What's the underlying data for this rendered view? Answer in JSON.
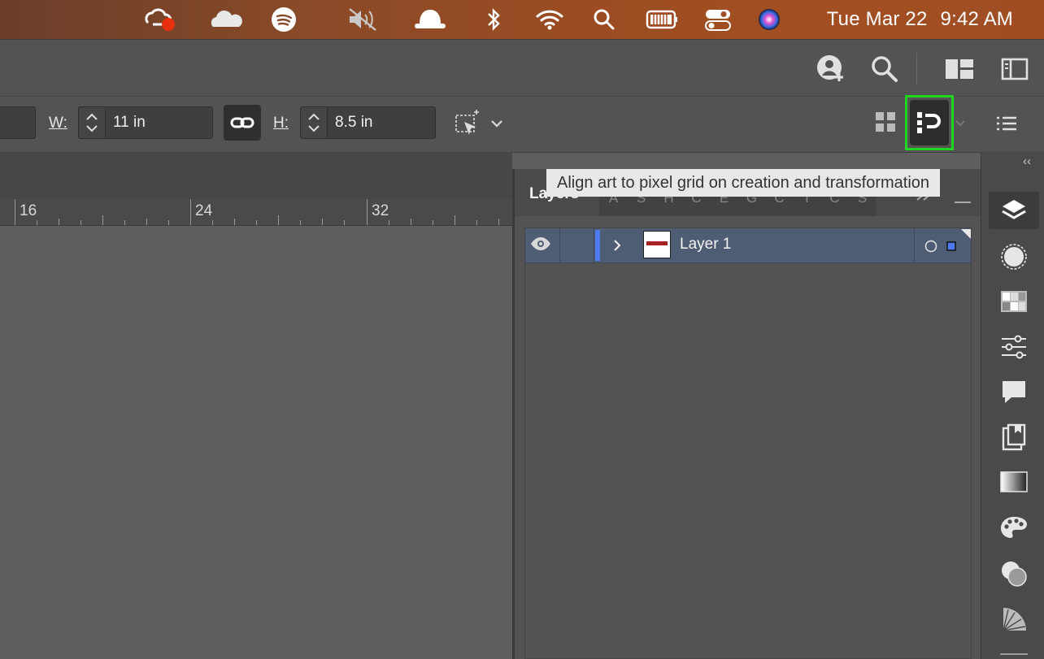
{
  "menubar": {
    "icons": [
      "creative-cloud-icon",
      "onedrive-icon",
      "spotify-icon",
      "muted-speaker-icon",
      "mask-icon",
      "bluetooth-icon",
      "wifi-icon",
      "spotlight-icon",
      "battery-icon",
      "control-center-icon",
      "siri-icon"
    ],
    "day_date": "Tue Mar 22",
    "time": "9:42 AM"
  },
  "appbar": {
    "icons": [
      "add-user-icon",
      "search-icon",
      "workspace-layout-icon",
      "panel-toggle-icon"
    ]
  },
  "controlbar": {
    "width_label": "W:",
    "width_value": "11 in",
    "height_label": "H:",
    "height_value": "8.5 in"
  },
  "tooltip": {
    "text": "Align art to pixel grid on creation and transformation"
  },
  "ruler": {
    "labels": [
      "16",
      "24",
      "32"
    ]
  },
  "layers_panel": {
    "title": "Layers",
    "tabs": [
      "A",
      "S",
      "H",
      "C",
      "E",
      "G",
      "C",
      "T",
      "C",
      "S"
    ],
    "layers": [
      {
        "name": "Layer 1",
        "visible": true,
        "color": "#4d7bef"
      }
    ]
  },
  "dock": {
    "collapse_label": "‹‹",
    "icons": [
      "layers-icon",
      "appearance-icon",
      "swatches-icon",
      "properties-icon",
      "comments-icon",
      "libraries-icon",
      "gradient-icon",
      "color-icon",
      "transparency-icon",
      "color-guide-icon"
    ]
  },
  "colors": {
    "highlight": "#1fd51f",
    "layer_selected": "#4e5d73",
    "layer_color": "#4d7bef"
  }
}
